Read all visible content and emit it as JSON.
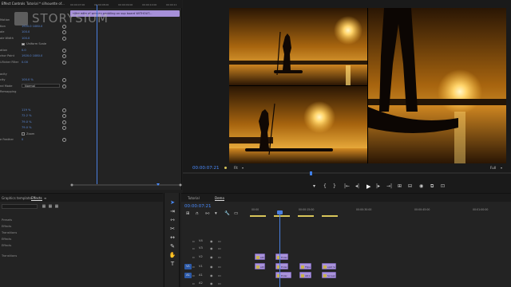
{
  "effect_controls": {
    "tab": "Effect Controls",
    "source": "Tutorial * silhouette of...",
    "clip_bar_label": "silhouette of woman paddling on sup board WITHOUT...",
    "ruler_labels": [
      "00:00:07:00",
      "00:00:08:00",
      "00:00:09:00",
      "00:00:10:00",
      "00:00:11"
    ],
    "watermark": "STORYSIUM",
    "rows": [
      {
        "label": "Motion",
        "type": "header"
      },
      {
        "label": "tion",
        "value": "1920.0   1080.0",
        "type": "value"
      },
      {
        "label": "ale",
        "value": "100.0",
        "type": "value"
      },
      {
        "label": "ale Width",
        "value": "100.0",
        "type": "value"
      },
      {
        "label": "",
        "value": "Uniform Scale",
        "type": "check",
        "checked": true
      },
      {
        "label": "ation",
        "value": "0.0",
        "type": "value"
      },
      {
        "label": "chor Point",
        "value": "1920.0   1080.0",
        "type": "value"
      },
      {
        "label": "i-flicker Filter",
        "value": "0.00",
        "type": "value"
      },
      {
        "label": "",
        "value": "",
        "type": "blank"
      },
      {
        "label": "acity",
        "type": "header"
      },
      {
        "label": "city",
        "value": "100.0 %",
        "type": "value"
      },
      {
        "label": "nd Mode",
        "value": "Normal",
        "type": "select"
      },
      {
        "label": "Remapping",
        "type": "header"
      },
      {
        "label": "",
        "value": "",
        "type": "blank"
      },
      {
        "label": "",
        "value": "",
        "type": "blank"
      },
      {
        "label": "",
        "value": "119 %",
        "type": "value"
      },
      {
        "label": "",
        "value": "72.2 %",
        "type": "value"
      },
      {
        "label": "",
        "value": "79.0 %",
        "type": "value"
      },
      {
        "label": "",
        "value": "79.0 %",
        "type": "value"
      },
      {
        "label": "",
        "value": "Zoom",
        "type": "check",
        "checked": false
      },
      {
        "label": "e Feather",
        "value": "0",
        "type": "value"
      }
    ]
  },
  "program_monitor": {
    "timecode": "00:00:07:21",
    "fit": "Fit",
    "resolution": "Full",
    "playhead_fraction": 0.39
  },
  "project_panel": {
    "tabs": [
      "Graphics template",
      "Effects"
    ],
    "items": [
      "Presets",
      "Effects",
      "Transitions",
      "Effects",
      "Effects",
      "Transitions"
    ]
  },
  "timeline": {
    "tabs": [
      "Tutorial",
      "Demo"
    ],
    "timecode": "00:00:07:21",
    "ruler_labels": [
      "00:00",
      "00:00:15:00",
      "00:00:30:00",
      "00:00:45:00",
      "00:01:00:00"
    ],
    "tracks": [
      {
        "name": "V4",
        "src": ""
      },
      {
        "name": "V3",
        "src": ""
      },
      {
        "name": "V2",
        "src": ""
      },
      {
        "name": "V1",
        "src": "V1"
      },
      {
        "name": "A1",
        "src": "A1"
      },
      {
        "name": "A2",
        "src": ""
      }
    ],
    "clips": [
      {
        "label": "silho",
        "track": 2
      },
      {
        "label": "silho",
        "track": 3
      },
      {
        "label": "Enlargi",
        "track": 2
      },
      {
        "label": "Enlargi",
        "track": 3
      },
      {
        "label": "Enlar",
        "track": 4
      },
      {
        "label": "Flips",
        "track": 3
      },
      {
        "label": "AD1",
        "track": 4
      },
      {
        "label": "split Sc",
        "track": 3
      },
      {
        "label": "Screen",
        "track": 4
      }
    ]
  }
}
